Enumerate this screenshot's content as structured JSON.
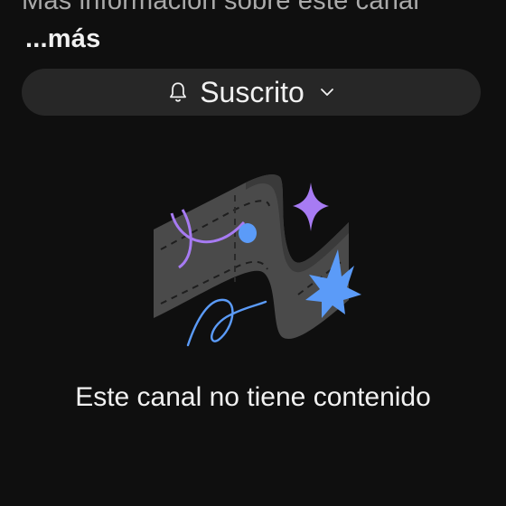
{
  "channel": {
    "about_text": "Más información sobre este canal",
    "more_link": "...más"
  },
  "subscribe_button": {
    "label": "Suscrito",
    "icon": "bell-icon",
    "dropdown_icon": "chevron-down-icon"
  },
  "empty_state": {
    "illustration": "empty-channel-illustration",
    "message": "Este canal no tiene contenido"
  },
  "colors": {
    "background": "#0f0f0f",
    "button_bg": "#272727",
    "text_primary": "#f1f1f1",
    "text_secondary": "#aaaaaa",
    "accent_purple": "#a77bf3",
    "accent_blue": "#5b9bf8"
  }
}
